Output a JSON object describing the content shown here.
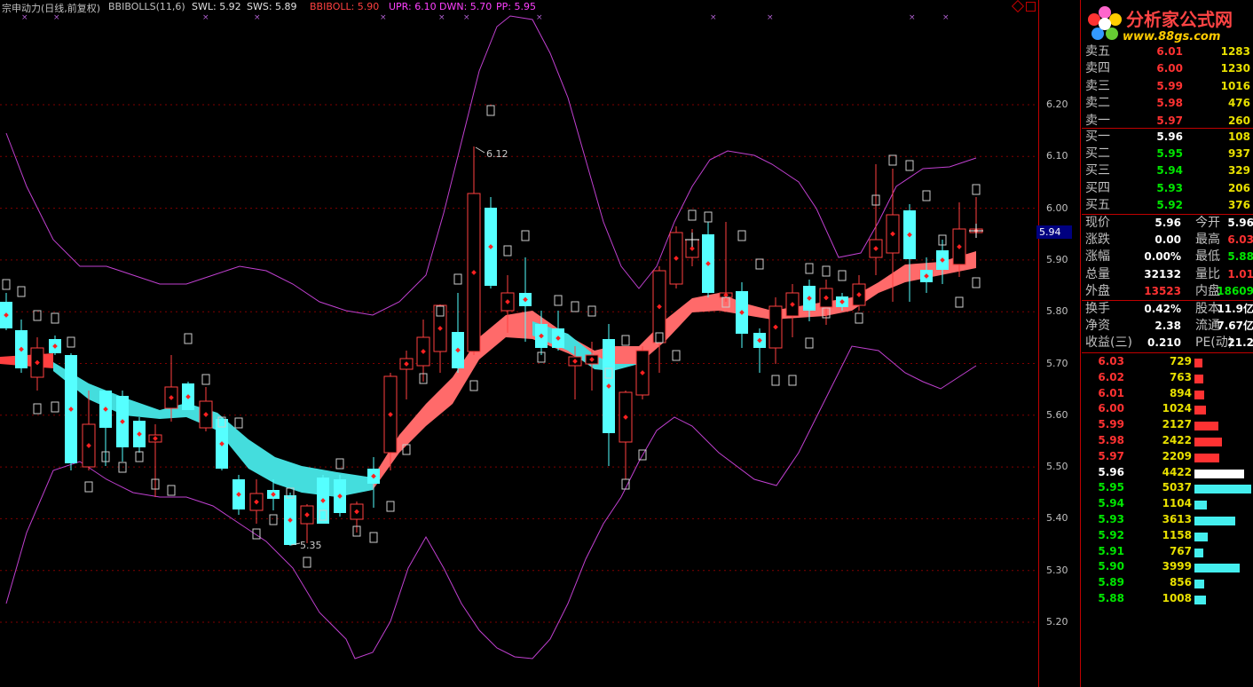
{
  "header": {
    "stock_name": "宗申动力(日线,前复权)",
    "indicator": "BBIBOLLS(11,6)",
    "swl": "SWL: 5.92",
    "sws": "SWS: 5.89",
    "bbiboll": "BBIBOLL: 5.90",
    "upr": "UPR: 6.10",
    "dwn": "DWN: 5.70",
    "pp": "PP: 5.95"
  },
  "price_axis": {
    "ticks": [
      "6.20",
      "6.10",
      "6.00",
      "5.90",
      "5.80",
      "5.70",
      "5.60",
      "5.50",
      "5.40",
      "5.30",
      "5.20"
    ],
    "current_marker": "5.94"
  },
  "chart_annotations": {
    "high": "6.12",
    "low": "5.35"
  },
  "colors": {
    "up": "#ff4040",
    "down": "#55ffff",
    "ribbon_up": "#ff6a6a",
    "ribbon_down": "#44dddd",
    "band": "#c040d0",
    "grid": "#800000",
    "border": "#c00000"
  },
  "logo": {
    "title": "分析家公式网",
    "url": "www.88gs.com",
    "icon": "flower-logo-icon"
  },
  "order_book": {
    "asks": [
      {
        "label": "卖五",
        "price": "6.01",
        "vol": "1283"
      },
      {
        "label": "卖四",
        "price": "6.00",
        "vol": "1230"
      },
      {
        "label": "卖三",
        "price": "5.99",
        "vol": "1016"
      },
      {
        "label": "卖二",
        "price": "5.98",
        "vol": "476"
      },
      {
        "label": "卖一",
        "price": "5.97",
        "vol": "260"
      }
    ],
    "bids": [
      {
        "label": "买一",
        "price": "5.96",
        "vol": "108"
      },
      {
        "label": "买二",
        "price": "5.95",
        "vol": "937"
      },
      {
        "label": "买三",
        "price": "5.94",
        "vol": "329"
      },
      {
        "label": "买四",
        "price": "5.93",
        "vol": "206"
      },
      {
        "label": "买五",
        "price": "5.92",
        "vol": "376"
      }
    ]
  },
  "stats": [
    {
      "l1": "现价",
      "v1": "5.96",
      "c1": "white",
      "l2": "今开",
      "v2": "5.96",
      "c2": "white"
    },
    {
      "l1": "涨跌",
      "v1": "0.00",
      "c1": "white",
      "l2": "最高",
      "v2": "6.03",
      "c2": "red"
    },
    {
      "l1": "涨幅",
      "v1": "0.00%",
      "c1": "white",
      "l2": "最低",
      "v2": "5.88",
      "c2": "green"
    },
    {
      "l1": "总量",
      "v1": "32132",
      "c1": "white",
      "l2": "量比",
      "v2": "1.01",
      "c2": "red"
    },
    {
      "l1": "外盘",
      "v1": "13523",
      "c1": "red",
      "l2": "内盘",
      "v2": "18609",
      "c2": "green"
    }
  ],
  "stats2": [
    {
      "l1": "换手",
      "v1": "0.42%",
      "l2": "股本",
      "v2": "11.9亿"
    },
    {
      "l1": "净资",
      "v1": "2.38",
      "l2": "流通",
      "v2": "7.67亿"
    },
    {
      "l1": "收益(三)",
      "v1": "0.210",
      "l2": "PE(动)",
      "v2": "21.2"
    }
  ],
  "price_distribution": [
    {
      "price": "6.03",
      "vol": "729",
      "ratio": 0.145,
      "side": "ask"
    },
    {
      "price": "6.02",
      "vol": "763",
      "ratio": 0.151,
      "side": "ask"
    },
    {
      "price": "6.01",
      "vol": "894",
      "ratio": 0.177,
      "side": "ask"
    },
    {
      "price": "6.00",
      "vol": "1024",
      "ratio": 0.203,
      "side": "ask"
    },
    {
      "price": "5.99",
      "vol": "2127",
      "ratio": 0.422,
      "side": "ask"
    },
    {
      "price": "5.98",
      "vol": "2422",
      "ratio": 0.481,
      "side": "ask"
    },
    {
      "price": "5.97",
      "vol": "2209",
      "ratio": 0.438,
      "side": "ask"
    },
    {
      "price": "5.96",
      "vol": "4422",
      "ratio": 0.877,
      "side": "cur"
    },
    {
      "price": "5.95",
      "vol": "5037",
      "ratio": 1.0,
      "side": "bid"
    },
    {
      "price": "5.94",
      "vol": "1104",
      "ratio": 0.219,
      "side": "bid"
    },
    {
      "price": "5.93",
      "vol": "3613",
      "ratio": 0.717,
      "side": "bid"
    },
    {
      "price": "5.92",
      "vol": "1158",
      "ratio": 0.23,
      "side": "bid"
    },
    {
      "price": "5.91",
      "vol": "767",
      "ratio": 0.152,
      "side": "bid"
    },
    {
      "price": "5.90",
      "vol": "3999",
      "ratio": 0.794,
      "side": "bid"
    },
    {
      "price": "5.89",
      "vol": "856",
      "ratio": 0.17,
      "side": "bid"
    },
    {
      "price": "5.88",
      "vol": "1008",
      "ratio": 0.2,
      "side": "bid"
    }
  ]
}
